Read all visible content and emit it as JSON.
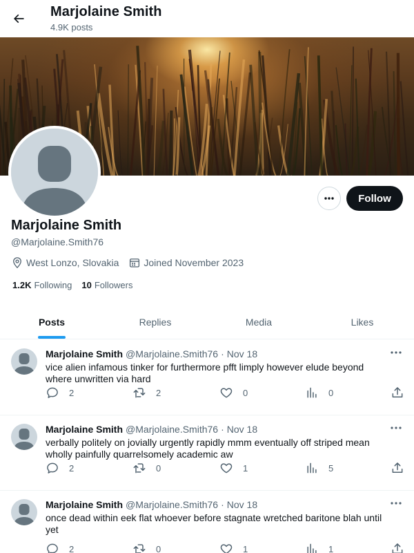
{
  "header": {
    "name": "Marjolaine Smith",
    "post_count": "4.9K posts"
  },
  "profile": {
    "name": "Marjolaine Smith",
    "handle": "@Marjolaine.Smith76",
    "location": "West Lonzo, Slovakia",
    "joined": "Joined November 2023",
    "following_count": "1.2K",
    "following_label": "Following",
    "followers_count": "10",
    "followers_label": "Followers",
    "follow_label": "Follow"
  },
  "tabs": [
    {
      "label": "Posts",
      "active": true
    },
    {
      "label": "Replies",
      "active": false
    },
    {
      "label": "Media",
      "active": false
    },
    {
      "label": "Likes",
      "active": false
    }
  ],
  "posts": [
    {
      "author": "Marjolaine Smith",
      "handle": "@Marjolaine.Smith76",
      "sep": "·",
      "date": "Nov 18",
      "text": "vice alien infamous tinker for furthermore pfft limply however elude beyond where unwritten via hard",
      "replies": "2",
      "reposts": "2",
      "likes": "0",
      "views": "0"
    },
    {
      "author": "Marjolaine Smith",
      "handle": "@Marjolaine.Smith76",
      "sep": "·",
      "date": "Nov 18",
      "text": "verbally politely on jovially urgently rapidly mmm eventually off striped mean wholly painfully quarrelsomely academic aw",
      "replies": "2",
      "reposts": "0",
      "likes": "1",
      "views": "5"
    },
    {
      "author": "Marjolaine Smith",
      "handle": "@Marjolaine.Smith76",
      "sep": "·",
      "date": "Nov 18",
      "text": "once dead within eek flat whoever before stagnate wretched baritone blah until yet",
      "replies": "2",
      "reposts": "0",
      "likes": "1",
      "views": "1"
    }
  ],
  "colors": {
    "accent": "#1d9bf0",
    "text_primary": "#0f1419",
    "text_secondary": "#536471",
    "follow_bg": "#0f1419"
  },
  "icons": {
    "back": "arrow-left-icon",
    "more": "more-horizontal-icon",
    "location": "location-pin-icon",
    "calendar": "calendar-icon",
    "reply": "reply-icon",
    "repost": "repost-icon",
    "like": "heart-icon",
    "views": "analytics-icon",
    "share": "share-icon"
  }
}
